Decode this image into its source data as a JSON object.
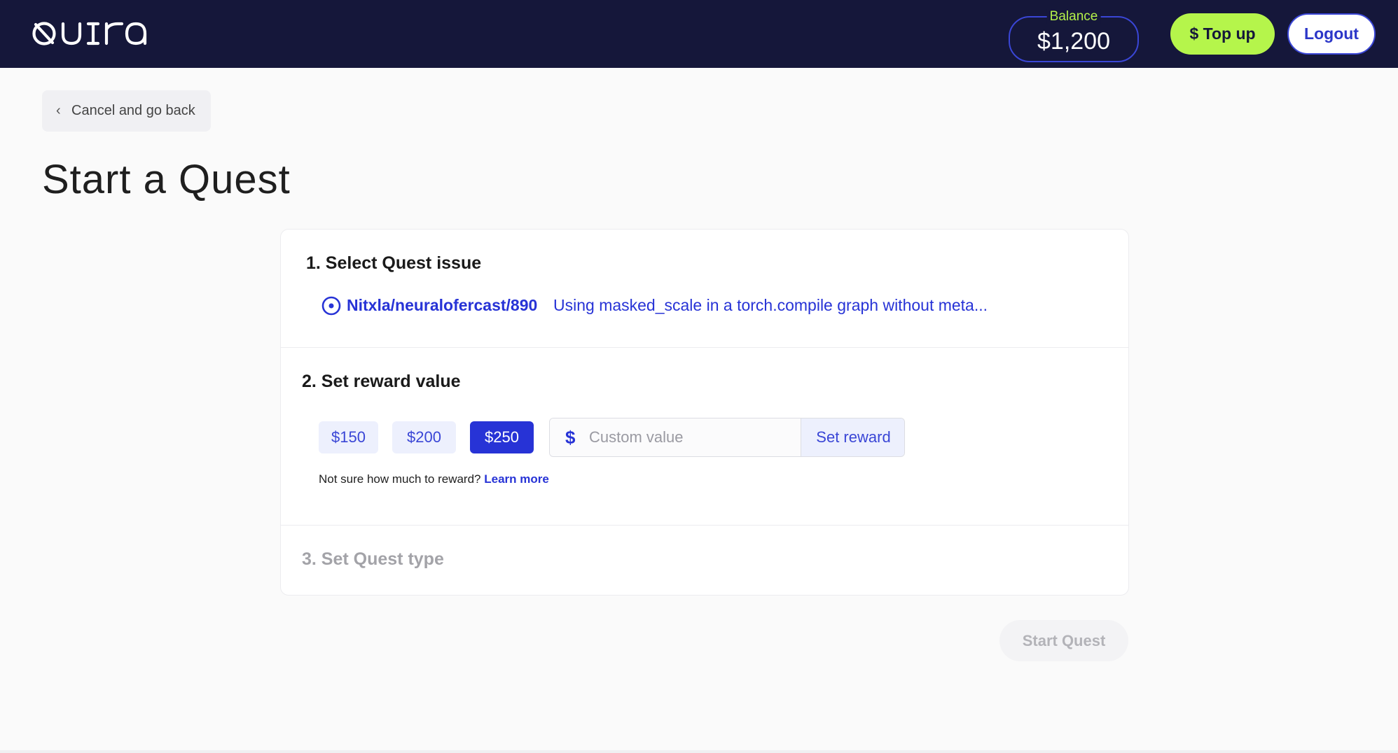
{
  "header": {
    "balance_label": "Balance",
    "balance_value": "$1,200",
    "topup_label": "$ Top up",
    "logout_label": "Logout"
  },
  "nav": {
    "back_label": "Cancel and go back"
  },
  "page": {
    "title": "Start a Quest"
  },
  "steps": {
    "issue": {
      "title": "1. Select Quest issue",
      "repo": "Nitxla/neuralofercast/890",
      "issue_title": "Using masked_scale in a torch.compile graph without meta..."
    },
    "reward": {
      "title": "2. Set reward value",
      "options": [
        "$150",
        "$200",
        "$250"
      ],
      "selected": "$250",
      "custom_placeholder": "Custom value",
      "custom_value": "",
      "set_reward_label": "Set reward",
      "help_text": "Not sure how much to reward?",
      "help_link": "Learn more"
    },
    "type": {
      "title": "3. Set Quest type"
    }
  },
  "actions": {
    "start_label": "Start Quest"
  },
  "colors": {
    "header_bg": "#15173a",
    "accent_blue": "#2733d6",
    "topup_green": "#b5f54b",
    "balance_label_green": "#b3f04a",
    "chip_bg": "#edf0fd"
  },
  "icons": {
    "brand": "quira-logo",
    "back": "chevron-left-icon",
    "issue": "issue-open-circle-icon",
    "currency": "dollar-icon"
  }
}
